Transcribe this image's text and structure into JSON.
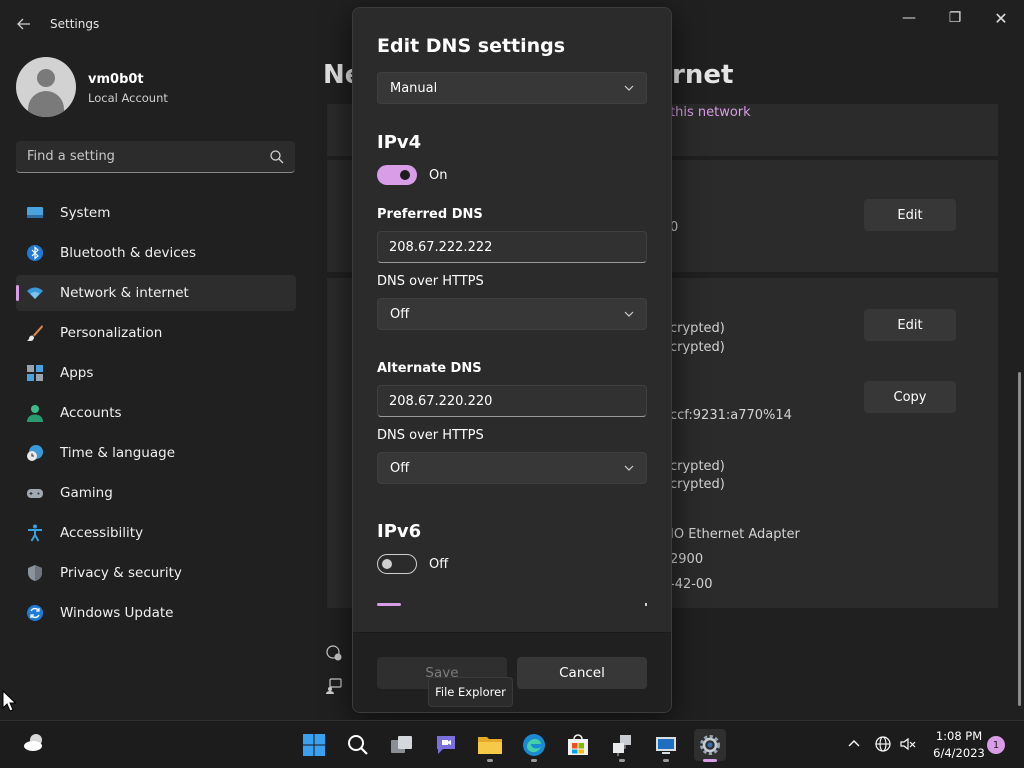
{
  "window": {
    "title": "Settings",
    "back_icon": "back-arrow-icon",
    "minimize_glyph": "—",
    "maximize_glyph": "❐",
    "close_glyph": "✕"
  },
  "user": {
    "name": "vm0b0t",
    "account_type": "Local Account"
  },
  "search": {
    "placeholder": "Find a setting"
  },
  "sidebar": {
    "items": [
      {
        "label": "System",
        "icon": "monitor-icon"
      },
      {
        "label": "Bluetooth & devices",
        "icon": "bluetooth-icon"
      },
      {
        "label": "Network & internet",
        "icon": "wifi-icon",
        "active": true
      },
      {
        "label": "Personalization",
        "icon": "brush-icon"
      },
      {
        "label": "Apps",
        "icon": "apps-icon"
      },
      {
        "label": "Accounts",
        "icon": "person-icon"
      },
      {
        "label": "Time & language",
        "icon": "clock-globe-icon"
      },
      {
        "label": "Gaming",
        "icon": "gamepad-icon"
      },
      {
        "label": "Accessibility",
        "icon": "accessibility-icon"
      },
      {
        "label": "Privacy & security",
        "icon": "shield-icon"
      },
      {
        "label": "Windows Update",
        "icon": "refresh-icon"
      }
    ]
  },
  "background": {
    "heading_left": "Ne",
    "heading_right": "rnet",
    "link_fragment": "this network",
    "fragments": {
      "f1": "0",
      "f2": "crypted)",
      "f3": "crypted)",
      "f4": "ccf:9231:a770%14",
      "f5": "crypted)",
      "f6": "crypted)",
      "f7": "IO Ethernet Adapter",
      "f8": "2900",
      "f9": "-42-00"
    },
    "buttons": {
      "edit_1": "Edit",
      "edit_2": "Edit",
      "copy": "Copy"
    }
  },
  "dialog": {
    "title": "Edit DNS settings",
    "mode": "Manual",
    "ipv4": {
      "heading": "IPv4",
      "toggle_state": "On",
      "preferred_label": "Preferred DNS",
      "preferred_value": "208.67.222.222",
      "doh_label_1": "DNS over HTTPS",
      "doh_value_1": "Off",
      "alternate_label": "Alternate DNS",
      "alternate_value": "208.67.220.220",
      "doh_label_2": "DNS over HTTPS",
      "doh_value_2": "Off"
    },
    "ipv6": {
      "heading": "IPv6",
      "toggle_state": "Off"
    },
    "save_label": "Save",
    "cancel_label": "Cancel"
  },
  "tooltip": "File Explorer",
  "taskbar": {
    "icons": [
      "start-icon",
      "search-icon",
      "task-view-icon",
      "chat-icon",
      "file-explorer-icon",
      "edge-icon",
      "store-icon",
      "network-connections-icon",
      "remote-desktop-icon",
      "settings-icon"
    ],
    "tray_icons": [
      "chevron-up-icon",
      "globe-icon",
      "volume-muted-icon"
    ],
    "time": "1:08 PM",
    "date": "6/4/2023",
    "notification_count": "1"
  },
  "colors": {
    "accent": "#d99ce6",
    "background": "#202020",
    "card": "#2b2b2b",
    "taskbar": "#1c1c1c"
  }
}
